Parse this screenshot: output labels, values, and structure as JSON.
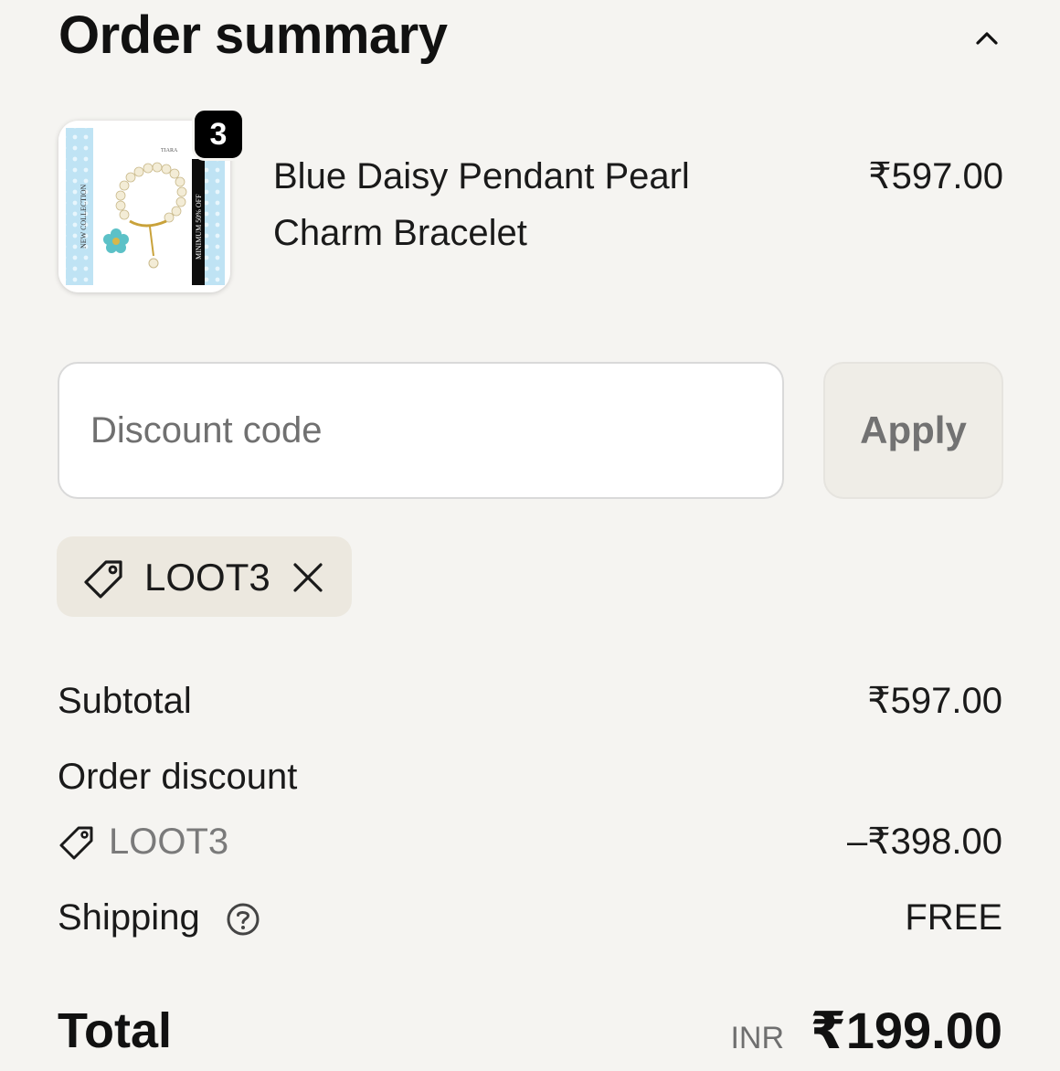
{
  "header": {
    "title": "Order summary",
    "toggle_icon": "chevron-up-icon"
  },
  "product": {
    "quantity": "3",
    "name": "Blue Daisy Pendant Pearl Charm Bracelet",
    "price": "₹597.00",
    "image_text_left": "NEW COLLECTION",
    "image_text_right": "MINIMUM 50% OFF",
    "image_brand": "TIARA"
  },
  "discount": {
    "placeholder": "Discount code",
    "apply_label": "Apply",
    "applied_code": "LOOT3",
    "chip_icon": "tag-icon",
    "remove_icon": "close-icon"
  },
  "summary": {
    "subtotal_label": "Subtotal",
    "subtotal_value": "₹597.00",
    "order_discount_label": "Order discount",
    "discount_code": "LOOT3",
    "discount_value": "–₹398.00",
    "shipping_label": "Shipping",
    "shipping_help_icon": "help-circle-icon",
    "shipping_value": "FREE",
    "total_label": "Total",
    "total_currency": "INR",
    "total_value": "₹199.00"
  },
  "colors": {
    "background": "#f5f4f1",
    "chip_background": "#ece8df",
    "apply_background": "#efede7",
    "thumb_blue": "#bfe3f4"
  }
}
